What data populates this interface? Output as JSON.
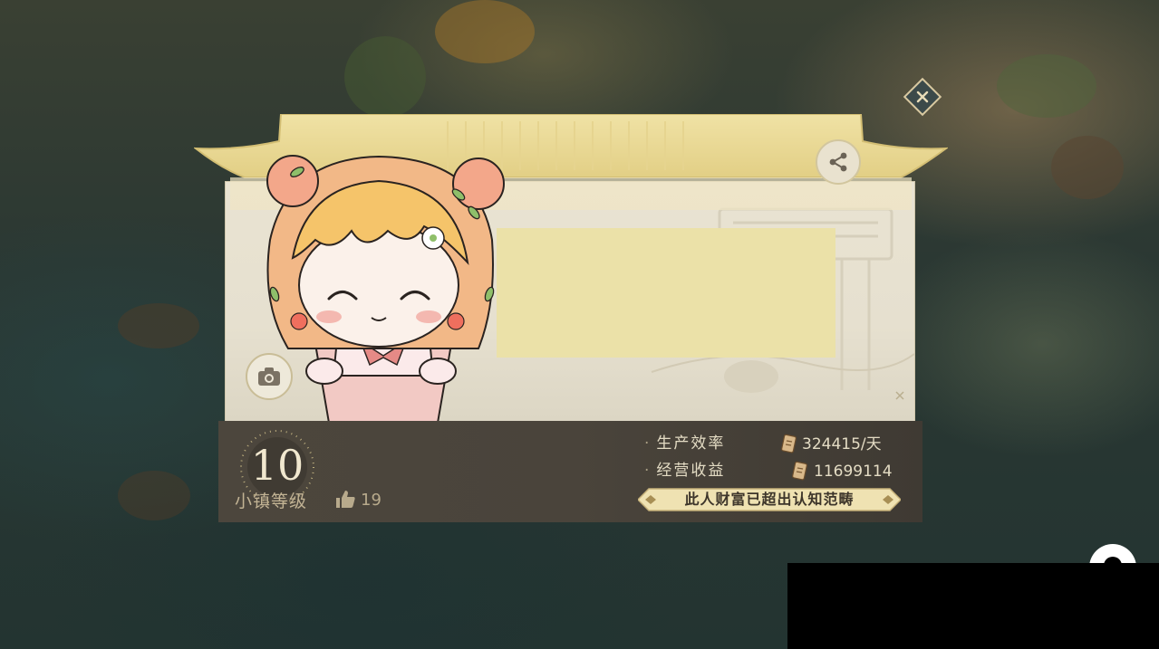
{
  "level": {
    "value": "10",
    "label": "小镇等级"
  },
  "likes": {
    "count": "19"
  },
  "stats": [
    {
      "label": "生产效率",
      "value": "324415/天"
    },
    {
      "label": "经营收益",
      "value": "11699114"
    }
  ],
  "wealth_banner": "此人财富已超出认知范畴",
  "icons": {
    "close": "close-x-icon",
    "share": "share-icon",
    "camera": "camera-icon",
    "thumb": "thumbs-up-icon",
    "currency": "scroll-currency-icon"
  },
  "colors": {
    "card_bg": "#e9e3d2",
    "roof_gold": "#e9d99a",
    "banner_fill": "#ebe1a8",
    "info_bar": "#4c463d",
    "text_light": "#e4dcc4",
    "text_muted": "#c2b394"
  }
}
